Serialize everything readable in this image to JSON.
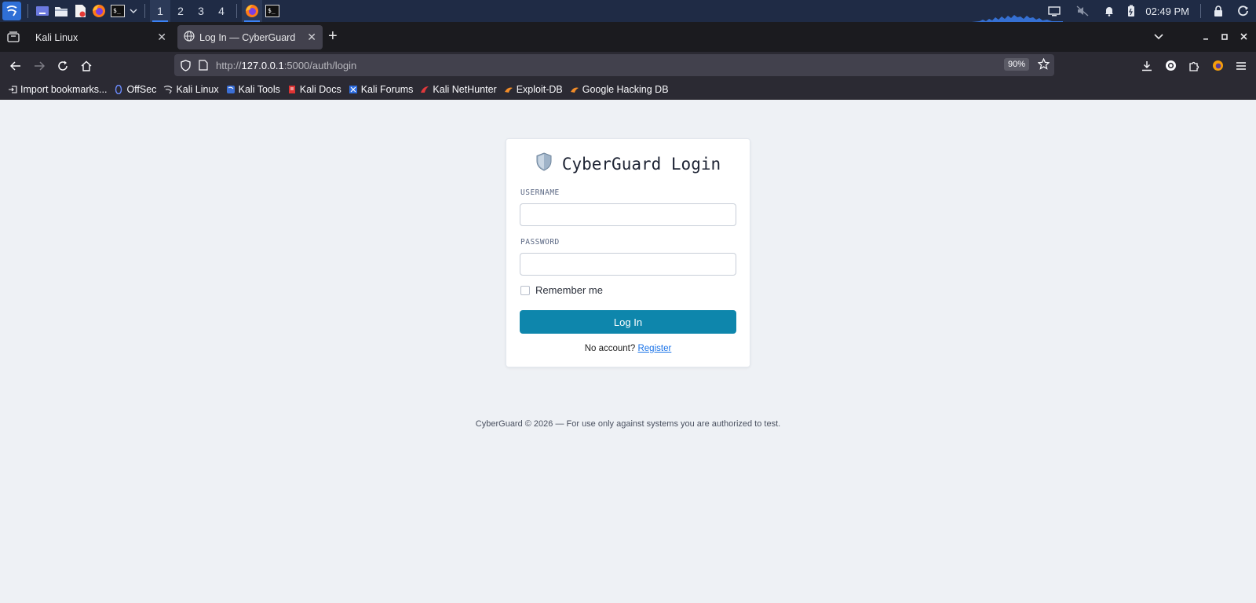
{
  "taskbar": {
    "workspaces": [
      "1",
      "2",
      "3",
      "4"
    ],
    "active_workspace": "1",
    "clock": "02:49 PM",
    "left_icons": [
      "kali-menu-icon",
      "desktop-icon",
      "file-manager-icon",
      "text-editor-icon",
      "firefox-icon",
      "terminal-icon",
      "chevron-down-icon"
    ],
    "right_icons": [
      "display-icon",
      "volume-muted-icon",
      "notification-bell-icon",
      "battery-icon",
      "lock-icon",
      "power-icon"
    ]
  },
  "browser": {
    "tabs": [
      {
        "title": "Kali Linux",
        "active": false
      },
      {
        "title": "Log In — CyberGuard",
        "active": true
      }
    ],
    "url_prefix": "http://",
    "url_host": "127.0.0.1",
    "url_rest": ":5000/auth/login",
    "zoom": "90%",
    "bookmarks": [
      "Import bookmarks...",
      "OffSec",
      "Kali Linux",
      "Kali Tools",
      "Kali Docs",
      "Kali Forums",
      "Kali NetHunter",
      "Exploit-DB",
      "Google Hacking DB"
    ]
  },
  "login": {
    "title": "CyberGuard Login",
    "username_label": "USERNAME",
    "username_value": "",
    "password_label": "PASSWORD",
    "password_value": "",
    "remember_label": "Remember me",
    "remember_checked": false,
    "submit_label": "Log In",
    "no_account_text": "No account?",
    "register_link": "Register"
  },
  "footer": {
    "text": "CyberGuard © 2026 — For use only against systems you are authorized to test."
  },
  "colors": {
    "taskbar_bg": "#1f2b45",
    "tabstrip_bg": "#1b1b1f",
    "toolbar_bg": "#2b2a33",
    "page_bg": "#eef1f5",
    "button_primary": "#0e86ac",
    "link": "#1a73e8"
  }
}
